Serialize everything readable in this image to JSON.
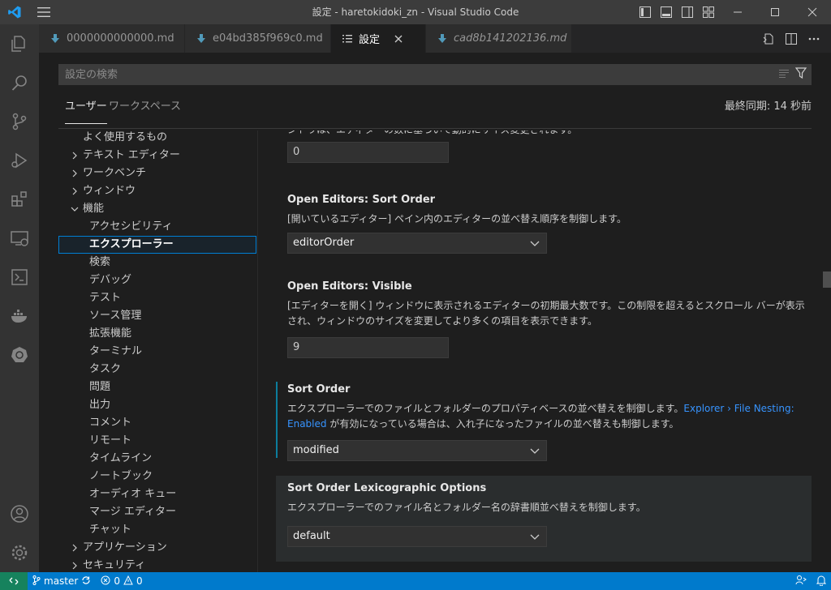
{
  "window": {
    "title": "設定 - haretokidoki_zn - Visual Studio Code"
  },
  "activity_icons": [
    "files-icon",
    "search-icon",
    "source-control-icon",
    "run-debug-icon",
    "extensions-icon",
    "remote-explorer-icon",
    "terminal-icon",
    "docker-icon",
    "kubernetes-icon",
    "account-icon",
    "settings-gear-icon"
  ],
  "tabs": [
    {
      "label": "0000000000000.md",
      "icon": "markdown-download-icon",
      "active": false,
      "italic": false
    },
    {
      "label": "e04bd385f969c0.md",
      "icon": "markdown-download-icon",
      "active": false,
      "italic": false
    },
    {
      "label": "設定",
      "icon": "settings-list-icon",
      "active": true,
      "italic": false
    },
    {
      "label": "cad8b141202136.md",
      "icon": "markdown-download-icon",
      "active": false,
      "italic": true
    }
  ],
  "search": {
    "placeholder": "設定の検索"
  },
  "scopes": {
    "user": "ユーザー",
    "workspace": "ワークスペース",
    "last_sync": "最終同期: 14 秒前"
  },
  "toc": [
    {
      "label": "よく使用するもの",
      "level": 0,
      "expandable": false
    },
    {
      "label": "テキスト エディター",
      "level": 0,
      "expandable": true,
      "expanded": false
    },
    {
      "label": "ワークベンチ",
      "level": 0,
      "expandable": true,
      "expanded": false
    },
    {
      "label": "ウィンドウ",
      "level": 0,
      "expandable": true,
      "expanded": false
    },
    {
      "label": "機能",
      "level": 0,
      "expandable": true,
      "expanded": true
    },
    {
      "label": "アクセシビリティ",
      "level": 1
    },
    {
      "label": "エクスプローラー",
      "level": 1,
      "selected": true
    },
    {
      "label": "検索",
      "level": 1
    },
    {
      "label": "デバッグ",
      "level": 1
    },
    {
      "label": "テスト",
      "level": 1
    },
    {
      "label": "ソース管理",
      "level": 1
    },
    {
      "label": "拡張機能",
      "level": 1
    },
    {
      "label": "ターミナル",
      "level": 1
    },
    {
      "label": "タスク",
      "level": 1
    },
    {
      "label": "問題",
      "level": 1
    },
    {
      "label": "出力",
      "level": 1
    },
    {
      "label": "コメント",
      "level": 1
    },
    {
      "label": "リモート",
      "level": 1
    },
    {
      "label": "タイムライン",
      "level": 1
    },
    {
      "label": "ノートブック",
      "level": 1
    },
    {
      "label": "オーディオ キュー",
      "level": 1
    },
    {
      "label": "マージ エディター",
      "level": 1
    },
    {
      "label": "チャット",
      "level": 1
    },
    {
      "label": "アプリケーション",
      "level": 0,
      "expandable": true,
      "expanded": false
    },
    {
      "label": "セキュリティ",
      "level": 0,
      "expandable": true,
      "expanded": false
    }
  ],
  "settings": {
    "partial": {
      "desc": "ントウは、エディターの数に基づいて動的にサイズ変更されます。",
      "value": "0"
    },
    "sort_order_editors": {
      "category": "Open Editors: ",
      "name": "Sort Order",
      "desc": "[開いているエディター] ペイン内のエディターの並べ替え順序を制御します。",
      "value": "editorOrder"
    },
    "visible": {
      "category": "Open Editors: ",
      "name": "Visible",
      "desc": "[エディターを開く] ウィンドウに表示されるエディターの初期最大数です。この制限を超えるとスクロール バーが表示され、ウィンドウのサイズを変更してより多くの項目を表示できます。",
      "value": "9"
    },
    "sort_order": {
      "name": "Sort Order",
      "desc_before": "エクスプローラーでのファイルとフォルダーのプロパティベースの並べ替えを制御します。",
      "desc_link": "Explorer › File Nesting: Enabled",
      "desc_after": " が有効になっている場合は、入れ子になったファイルの並べ替えも制御します。",
      "value": "modified"
    },
    "lexicographic": {
      "name": "Sort Order Lexicographic Options",
      "desc": "エクスプローラーでのファイル名とフォルダー名の辞書順並べ替えを制御します。",
      "value": "default"
    }
  },
  "statusbar": {
    "branch": "master",
    "errors": "0",
    "warnings": "0"
  },
  "colors": {
    "status_bar": "#007acc",
    "link": "#3794ff",
    "focus_border": "#007fd4"
  }
}
